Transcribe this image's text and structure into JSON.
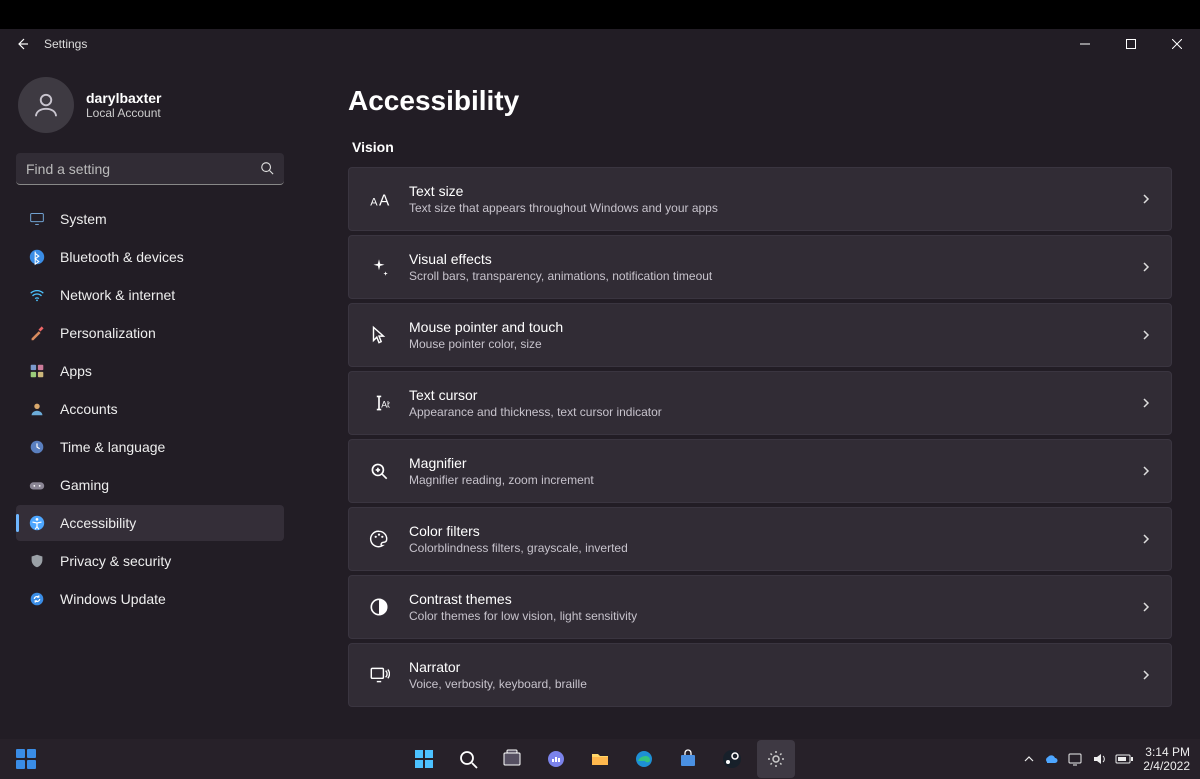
{
  "window": {
    "title": "Settings"
  },
  "user": {
    "name": "darylbaxter",
    "subtitle": "Local Account"
  },
  "search": {
    "placeholder": "Find a setting"
  },
  "sidebar": {
    "items": [
      {
        "label": "System",
        "icon": "system"
      },
      {
        "label": "Bluetooth & devices",
        "icon": "bluetooth"
      },
      {
        "label": "Network & internet",
        "icon": "wifi"
      },
      {
        "label": "Personalization",
        "icon": "brush"
      },
      {
        "label": "Apps",
        "icon": "apps"
      },
      {
        "label": "Accounts",
        "icon": "accounts"
      },
      {
        "label": "Time & language",
        "icon": "time"
      },
      {
        "label": "Gaming",
        "icon": "gaming"
      },
      {
        "label": "Accessibility",
        "icon": "accessibility"
      },
      {
        "label": "Privacy & security",
        "icon": "privacy"
      },
      {
        "label": "Windows Update",
        "icon": "update"
      }
    ],
    "active_index": 8
  },
  "page": {
    "title": "Accessibility",
    "section": "Vision",
    "cards": [
      {
        "title": "Text size",
        "desc": "Text size that appears throughout Windows and your apps",
        "icon": "textsize"
      },
      {
        "title": "Visual effects",
        "desc": "Scroll bars, transparency, animations, notification timeout",
        "icon": "sparkle"
      },
      {
        "title": "Mouse pointer and touch",
        "desc": "Mouse pointer color, size",
        "icon": "pointer"
      },
      {
        "title": "Text cursor",
        "desc": "Appearance and thickness, text cursor indicator",
        "icon": "textcursor"
      },
      {
        "title": "Magnifier",
        "desc": "Magnifier reading, zoom increment",
        "icon": "magnifier"
      },
      {
        "title": "Color filters",
        "desc": "Colorblindness filters, grayscale, inverted",
        "icon": "palette"
      },
      {
        "title": "Contrast themes",
        "desc": "Color themes for low vision, light sensitivity",
        "icon": "contrast"
      },
      {
        "title": "Narrator",
        "desc": "Voice, verbosity, keyboard, braille",
        "icon": "narrator"
      }
    ]
  },
  "taskbar": {
    "time": "3:14 PM",
    "date": "2/4/2022"
  }
}
